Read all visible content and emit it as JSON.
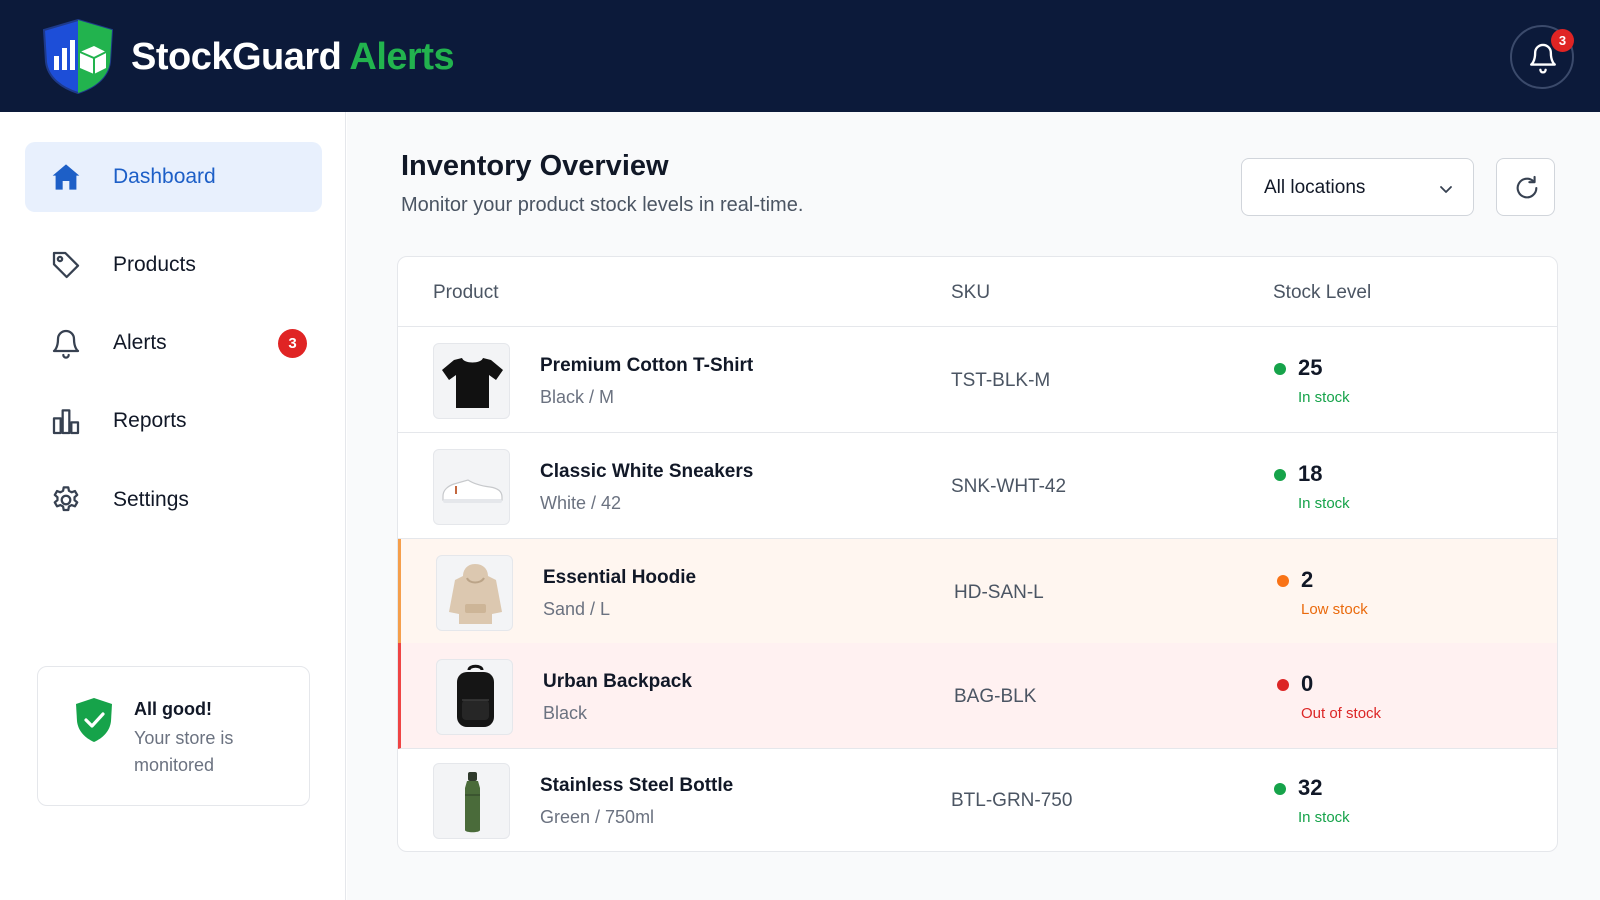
{
  "header": {
    "brand_primary": "StockGuard",
    "brand_accent": "Alerts",
    "notification_count": "3",
    "accent_color": "#22b34e",
    "background_color": "#0c1a3a"
  },
  "sidebar": {
    "items": [
      {
        "label": "Dashboard",
        "icon": "home-icon",
        "active": true
      },
      {
        "label": "Products",
        "icon": "tag-icon"
      },
      {
        "label": "Alerts",
        "icon": "bell-icon",
        "badge": "3"
      },
      {
        "label": "Reports",
        "icon": "bar-chart-icon"
      },
      {
        "label": "Settings",
        "icon": "gear-icon"
      }
    ],
    "status_card": {
      "title": "All good!",
      "text": "Your store is monitored",
      "icon": "shield-check-icon"
    }
  },
  "main": {
    "title": "Inventory Overview",
    "subtitle": "Monitor your product stock levels in real-time.",
    "location_select": {
      "value": "All locations"
    },
    "refresh_icon": "refresh-icon",
    "table": {
      "columns": [
        "Product",
        "SKU",
        "Stock Level"
      ],
      "rows": [
        {
          "name": "Premium Cotton T-Shirt",
          "variant": "Black / M",
          "sku": "TST-BLK-M",
          "qty": "25",
          "status": "In stock",
          "status_color": "#16a34a"
        },
        {
          "name": "Classic White Sneakers",
          "variant": "White / 42",
          "sku": "SNK-WHT-42",
          "qty": "18",
          "status": "In stock",
          "status_color": "#16a34a"
        },
        {
          "name": "Essential Hoodie",
          "variant": "Sand / L",
          "sku": "HD-SAN-L",
          "qty": "2",
          "status": "Low stock",
          "status_color": "#ea6a0c"
        },
        {
          "name": "Urban Backpack",
          "variant": "Black",
          "sku": "BAG-BLK",
          "qty": "0",
          "status": "Out of stock",
          "status_color": "#dc2626"
        },
        {
          "name": "Stainless Steel Bottle",
          "variant": "Green / 750ml",
          "sku": "BTL-GRN-750",
          "qty": "32",
          "status": "In stock",
          "status_color": "#16a34a"
        }
      ]
    }
  }
}
